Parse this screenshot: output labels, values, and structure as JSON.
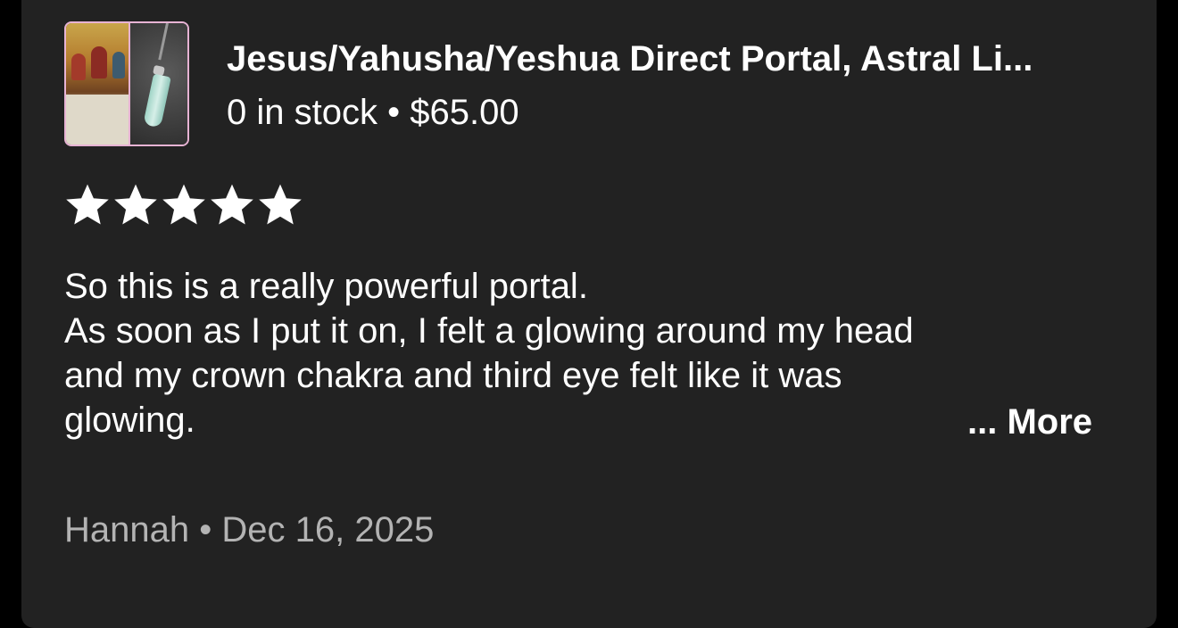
{
  "listing": {
    "title": "Jesus/Yahusha/Yeshua Direct Portal, Astral Li...",
    "stock": "0 in stock",
    "separator": "•",
    "price": "$65.00"
  },
  "rating": {
    "stars": 5,
    "max": 5,
    "color": "#ffffff"
  },
  "review": {
    "lines": [
      "So this is a really powerful portal.",
      "As soon as I put it on, I felt a glowing around my head",
      "and my crown chakra and third eye felt like it was",
      "glowing."
    ],
    "more_label": "... More"
  },
  "footer": {
    "author": "Hannah",
    "separator": "•",
    "date": "Dec 16, 2025"
  },
  "colors": {
    "card_background": "#222222",
    "page_background": "#000000",
    "muted_text": "#b3b3b3",
    "thumbnail_border": "#e7b3d4"
  }
}
